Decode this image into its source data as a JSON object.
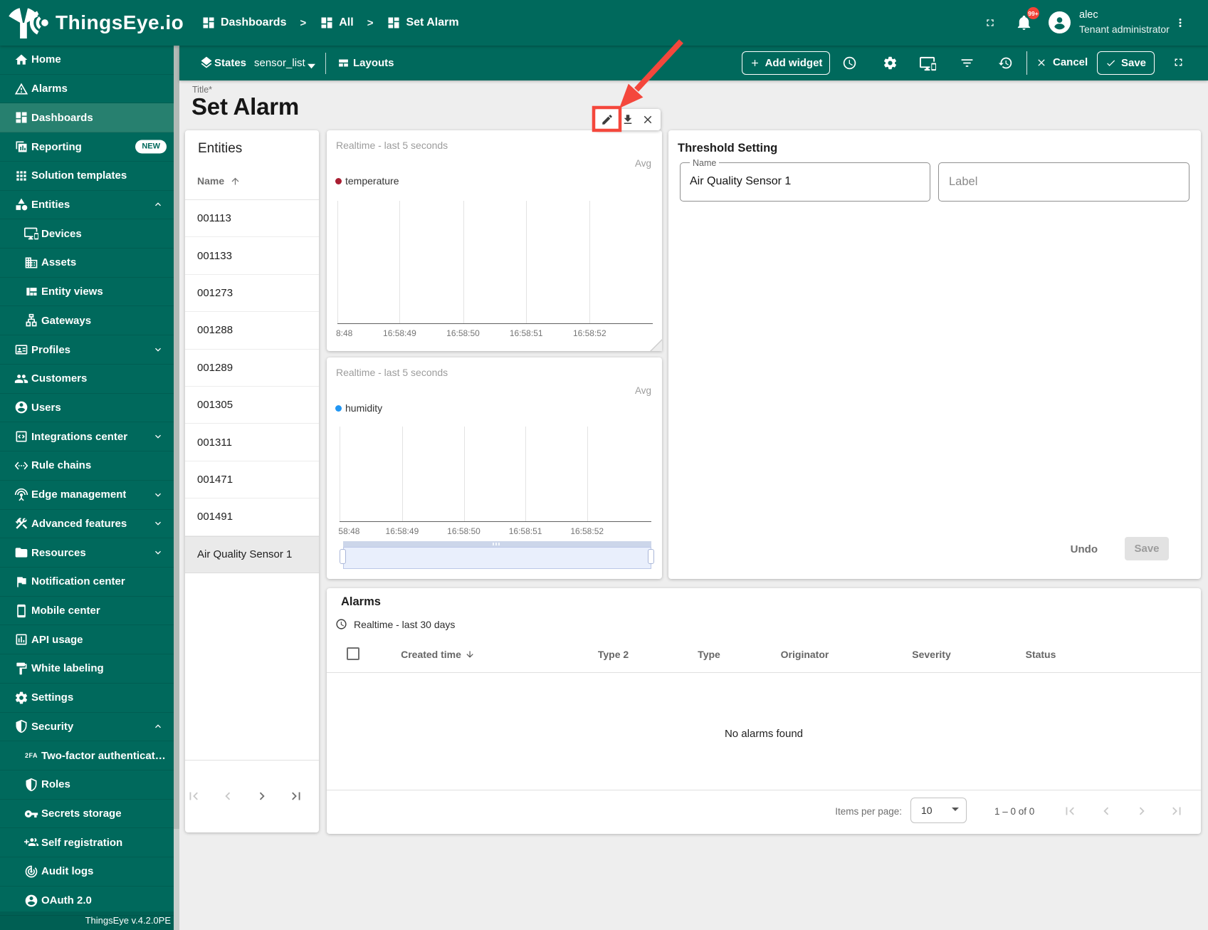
{
  "colors": {
    "primary": "#00695c",
    "primary_selected": "#27806f",
    "accent_red": "#f44336",
    "annotation_red": "#f4473c",
    "temperature_series": "#a91e32",
    "humidity_series": "#2196f3"
  },
  "topbar": {
    "brand": "ThingsEye.io",
    "breadcrumbs": [
      {
        "label": "Dashboards",
        "icon": "dashboards-icon"
      },
      {
        "label": "All",
        "icon": "dashboards-icon"
      },
      {
        "label": "Set Alarm",
        "icon": "dashboards-icon"
      }
    ],
    "breadcrumb_separator": ">",
    "notifications_badge": "99+",
    "user": {
      "name": "alec",
      "role": "Tenant administrator"
    }
  },
  "toolbar": {
    "states_label": "States",
    "state_value": "sensor_list",
    "layouts_label": "Layouts",
    "add_widget_label": "Add widget",
    "cancel_label": "Cancel",
    "save_label": "Save"
  },
  "sidebar": {
    "items": [
      {
        "label": "Home",
        "icon": "home-icon"
      },
      {
        "label": "Alarms",
        "icon": "alarms-icon"
      },
      {
        "label": "Dashboards",
        "icon": "dashboards-icon",
        "selected": true
      },
      {
        "label": "Reporting",
        "icon": "reporting-icon",
        "badge": "NEW"
      },
      {
        "label": "Solution templates",
        "icon": "solution-templates-icon"
      },
      {
        "label": "Entities",
        "icon": "entities-icon",
        "chevron": "up"
      },
      {
        "label": "Devices",
        "icon": "devices-icon",
        "sub": true
      },
      {
        "label": "Assets",
        "icon": "assets-icon",
        "sub": true
      },
      {
        "label": "Entity views",
        "icon": "entity-views-icon",
        "sub": true
      },
      {
        "label": "Gateways",
        "icon": "gateways-icon",
        "sub": true
      },
      {
        "label": "Profiles",
        "icon": "profiles-icon",
        "chevron": "down"
      },
      {
        "label": "Customers",
        "icon": "customers-icon"
      },
      {
        "label": "Users",
        "icon": "users-icon"
      },
      {
        "label": "Integrations center",
        "icon": "integrations-center-icon",
        "chevron": "down"
      },
      {
        "label": "Rule chains",
        "icon": "rule-chains-icon"
      },
      {
        "label": "Edge management",
        "icon": "edge-management-icon",
        "chevron": "down"
      },
      {
        "label": "Advanced features",
        "icon": "advanced-features-icon",
        "chevron": "down"
      },
      {
        "label": "Resources",
        "icon": "resources-icon",
        "chevron": "down"
      },
      {
        "label": "Notification center",
        "icon": "notification-center-icon"
      },
      {
        "label": "Mobile center",
        "icon": "mobile-center-icon"
      },
      {
        "label": "API usage",
        "icon": "api-usage-icon"
      },
      {
        "label": "White labeling",
        "icon": "white-labeling-icon"
      },
      {
        "label": "Settings",
        "icon": "settings-icon"
      },
      {
        "label": "Security",
        "icon": "security-icon",
        "chevron": "up"
      },
      {
        "label": "Two-factor authentication",
        "icon": "two-factor-icon",
        "icon_text": "2FA",
        "sub": true
      },
      {
        "label": "Roles",
        "icon": "roles-icon",
        "sub": true
      },
      {
        "label": "Secrets storage",
        "icon": "secrets-storage-icon",
        "sub": true
      },
      {
        "label": "Self registration",
        "icon": "self-registration-icon",
        "sub": true
      },
      {
        "label": "Audit logs",
        "icon": "audit-logs-icon",
        "sub": true
      },
      {
        "label": "OAuth 2.0",
        "icon": "oauth-icon",
        "sub": true
      }
    ],
    "footer": "ThingsEye v.4.2.0PE"
  },
  "page": {
    "title_label": "Title*",
    "title": "Set Alarm"
  },
  "entities_panel": {
    "title": "Entities",
    "column": "Name",
    "sort": "asc",
    "rows": [
      "001113",
      "001133",
      "001273",
      "001288",
      "001289",
      "001305",
      "001311",
      "001471",
      "001491",
      "Air Quality Sensor 1"
    ],
    "selected_row": "Air Quality Sensor 1",
    "paginator": {
      "first_enabled": false,
      "prev_enabled": false,
      "next_enabled": true,
      "last_enabled": true
    }
  },
  "chart_data": [
    {
      "type": "line",
      "title": "Realtime - last 5 seconds",
      "aggregation": "Avg",
      "legend": [
        "temperature"
      ],
      "series": [
        {
          "name": "temperature",
          "color": "#a91e32",
          "values": []
        }
      ],
      "x_ticks": [
        "8:48",
        "16:58:49",
        "16:58:50",
        "16:58:51",
        "16:58:52"
      ],
      "grid": true,
      "note": "no data points visible"
    },
    {
      "type": "line",
      "title": "Realtime - last 5 seconds",
      "aggregation": "Avg",
      "legend": [
        "humidity"
      ],
      "series": [
        {
          "name": "humidity",
          "color": "#2196f3",
          "values": []
        }
      ],
      "x_ticks": [
        "58:48",
        "16:58:49",
        "16:58:50",
        "16:58:51",
        "16:58:52"
      ],
      "grid": true,
      "has_range_slider": true,
      "note": "no data points visible"
    }
  ],
  "threshold": {
    "title": "Threshold Setting",
    "name_label": "Name",
    "name_value": "Air Quality Sensor 1",
    "label_placeholder": "Label",
    "undo_label": "Undo",
    "save_label": "Save"
  },
  "alarms": {
    "title": "Alarms",
    "timewindow": "Realtime - last 30 days",
    "columns": [
      {
        "label": "Created time",
        "sort": "desc"
      },
      {
        "label": "Type 2"
      },
      {
        "label": "Type"
      },
      {
        "label": "Originator"
      },
      {
        "label": "Severity"
      },
      {
        "label": "Status"
      }
    ],
    "empty_text": "No alarms found",
    "items_per_page_label": "Items per page:",
    "items_per_page": "10",
    "range_text": "1 – 0 of 0",
    "paginator": {
      "first_enabled": false,
      "prev_enabled": false,
      "next_enabled": false,
      "last_enabled": false
    }
  },
  "widget_toolbar": {
    "icons": [
      "edit-icon",
      "download-icon",
      "close-icon"
    ]
  }
}
